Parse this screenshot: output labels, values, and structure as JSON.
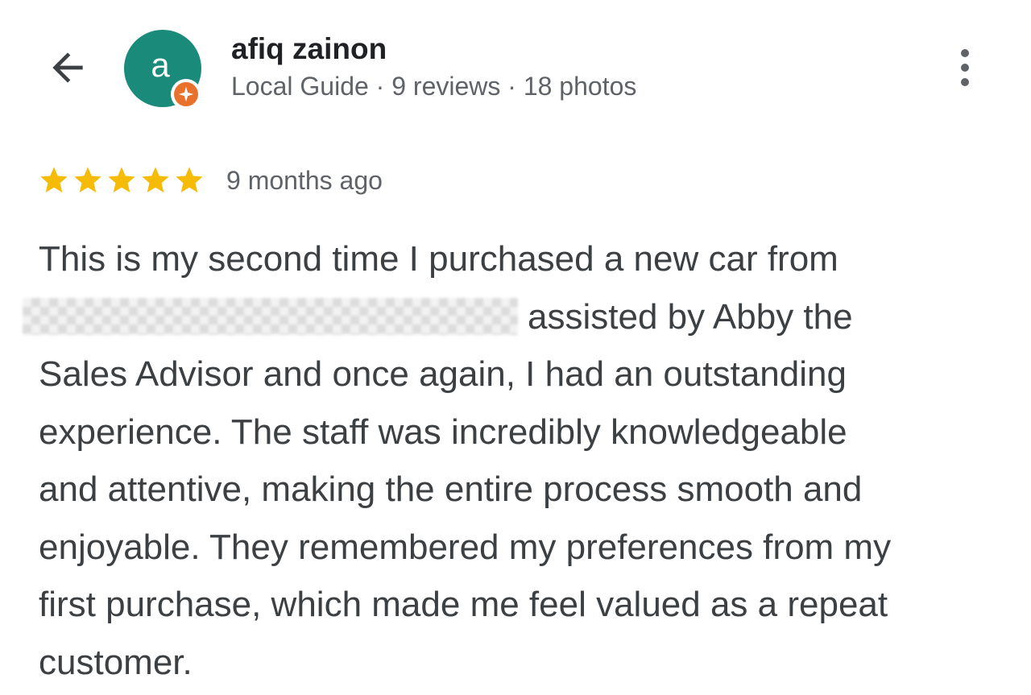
{
  "header": {
    "back_icon": "arrow-back-icon",
    "avatar_letter": "a",
    "avatar_color": "#1a8a7a",
    "badge_icon": "local-guide-badge-icon",
    "badge_color": "#e8712d",
    "user_name": "afiq zainon",
    "user_meta": "Local Guide · 9 reviews · 18 photos",
    "more_icon": "more-vert-icon"
  },
  "review": {
    "rating": 5,
    "rating_max": 5,
    "star_color": "#f6bb06",
    "date": "9 months ago",
    "lines": [
      "This is my second time I purchased a new car from",
      "assisted by Abby the",
      "Sales Advisor and once again, I had an outstanding",
      "experience. The staff was incredibly knowledgeable",
      "and attentive, making the entire process smooth and",
      "enjoyable. They remembered my preferences from my",
      "first purchase, which made me feel valued as a repeat",
      "customer."
    ]
  }
}
